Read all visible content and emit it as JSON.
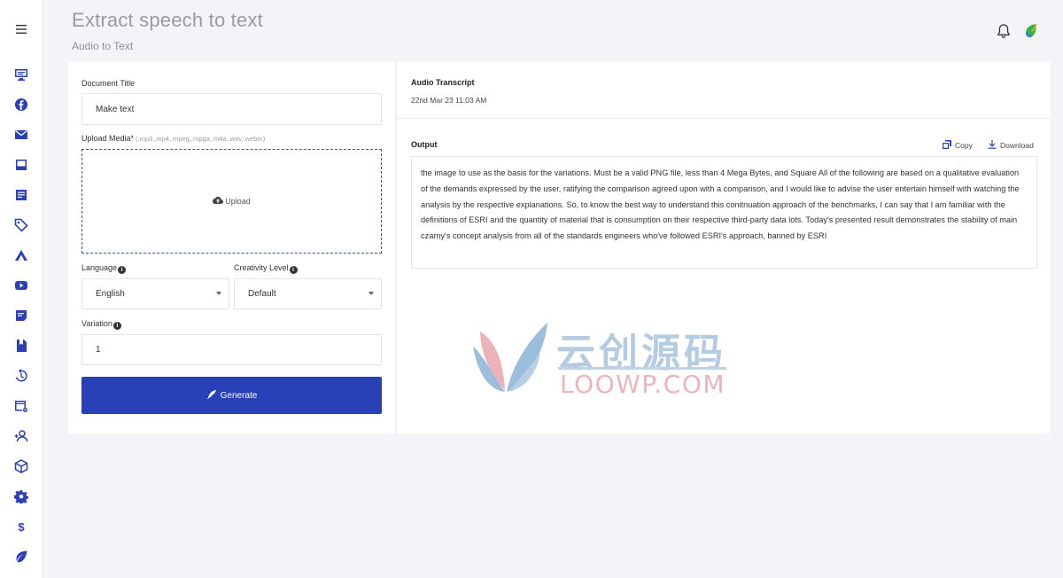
{
  "header": {
    "title": "Extract speech to text",
    "subtitle": "Audio to Text"
  },
  "sidebar": {
    "items": [
      "monitor-icon",
      "facebook-icon",
      "mail-icon",
      "book-icon",
      "document-icon",
      "tag-icon",
      "brand-a-icon",
      "youtube-icon",
      "edit-note-icon",
      "bookmark-file-icon",
      "history-icon",
      "table-settings-icon",
      "add-user-icon",
      "package-icon",
      "gear-icon",
      "dollar-icon",
      "leaf-icon"
    ]
  },
  "form": {
    "doc_title_label": "Document Title",
    "doc_title_value": "Make text",
    "upload_label": "Upload Media*",
    "upload_hint": "(.mp3,.mp4,.mpeg,.mpga,.m4a,.wav,.webm)",
    "upload_button": "Upload",
    "language_label": "Language",
    "language_value": "English",
    "creativity_label": "Creativity Level",
    "creativity_value": "Default",
    "variation_label": "Variation",
    "variation_value": "1",
    "generate_label": "Generate"
  },
  "transcript": {
    "title": "Audio Transcript",
    "date": "22nd Mar 23 11:03 AM",
    "output_label": "Output",
    "copy_label": "Copy",
    "download_label": "Download",
    "output_text": "the image to use as the basis for the variations. Must be a valid PNG file, less than 4 Mega Bytes, and Square All of the following are based on a qualitative evaluation of the demands expressed by the user, ratifying the comparison agreed upon with a comparison, and I would like to advise the user entertain himself with watching the analysis by the respective explanations. So, to know the best way to understand this conitnuation approach of the benchmarks, I can say that I am familiar with the definitions of ESRI and the quantity of material that is consumption on their respective third-party data lots. Today's presented result demonstrates the stability of main czarny's concept analysis from all of the standards engineers who've followed ESRI's approach, banned by ESRI"
  },
  "watermark": {
    "cn": "云创源码",
    "en": "LOOWP.COM"
  },
  "colors": {
    "accent": "#2941b7",
    "icon": "#2b3fb8"
  }
}
